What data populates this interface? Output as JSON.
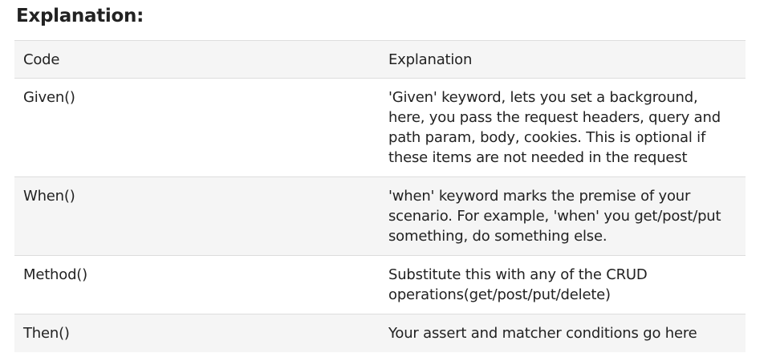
{
  "heading": "Explanation:",
  "table": {
    "headers": [
      "Code",
      "Explanation"
    ],
    "rows": [
      {
        "code": "Given()",
        "explanation": "'Given' keyword, lets you set a background, here, you pass the request headers, query and path param, body, cookies. This is optional if these items are not needed in the request"
      },
      {
        "code": "When()",
        "explanation": "'when' keyword marks the premise of your scenario. For example, 'when' you get/post/put something, do something else."
      },
      {
        "code": "Method()",
        "explanation": "Substitute this with any of the CRUD operations(get/post/put/delete)"
      },
      {
        "code": "Then()",
        "explanation": "Your assert and matcher conditions go here"
      }
    ]
  }
}
